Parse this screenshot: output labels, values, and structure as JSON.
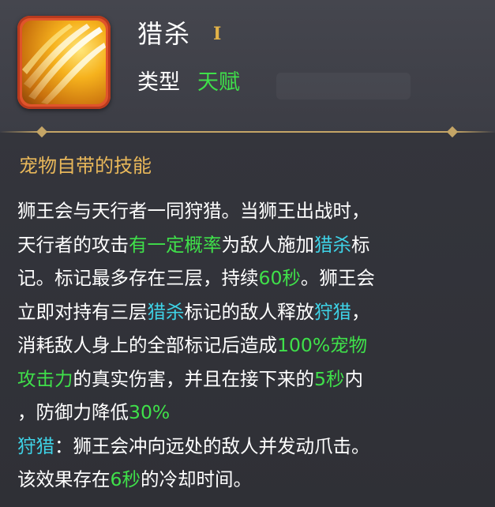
{
  "skill": {
    "name": "猎杀",
    "level_roman": "I",
    "type_label": "类型",
    "type_value": "天赋",
    "icon": "golden-claw-slash-icon"
  },
  "section_title": "宠物自带的技能",
  "description": {
    "l1": {
      "a": "狮王会与天行者一同狩猎。当狮王出战时，"
    },
    "l2": {
      "a": "天行者的攻击",
      "b": "有一定概率",
      "c": "为敌人施加",
      "d": "猎杀",
      "e": "标"
    },
    "l3": {
      "a": "记。标记最多存在三层，持续",
      "b": "60秒",
      "c": "。狮王会"
    },
    "l4": {
      "a": "立即对持有三层",
      "b": "猎杀",
      "c": "标记的敌人释放",
      "d": "狩猎",
      "e": "，"
    },
    "l5": {
      "a": "消耗敌人身上的全部标记后造成",
      "b": "100%宠物"
    },
    "l6": {
      "a": "攻击力",
      "b": "的真实伤害，并且在接下来的",
      "c": "5秒",
      "d": "内"
    },
    "l7": {
      "a": "，防御力降低",
      "b": "30%"
    },
    "l8": {
      "a": "狩猎",
      "b": "：狮王会冲向远处的敌人并发动爪击。"
    },
    "l9": {
      "a": "该效果存在",
      "b": "6秒",
      "c": "的冷却时间。"
    }
  },
  "colors": {
    "highlight_green": "#3fe04a",
    "highlight_cyan": "#3ed2e6",
    "section_gold": "#e8b75a",
    "roman_gold": "#e2b248"
  }
}
